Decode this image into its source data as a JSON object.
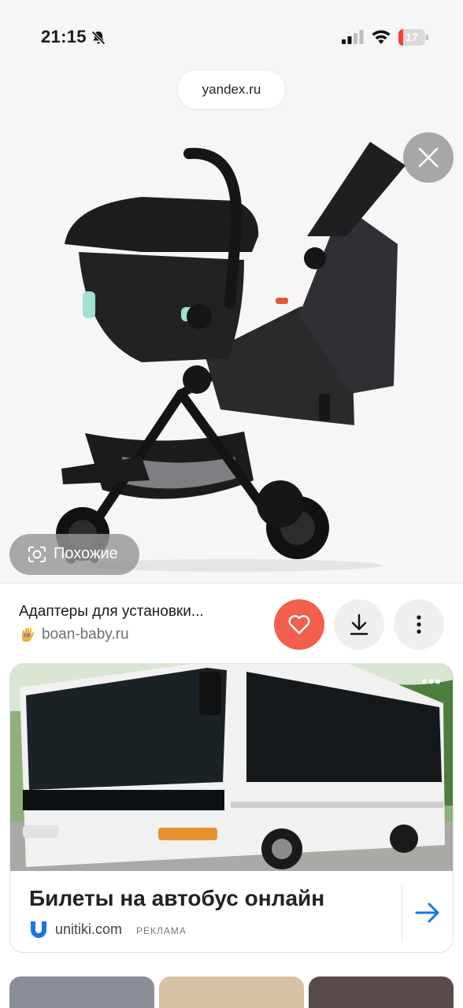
{
  "status_bar": {
    "time": "21:15",
    "battery_level": "17",
    "battery_fraction": 0.17,
    "icons": [
      "bell-slash-icon",
      "signal-icon",
      "wifi-icon",
      "battery-icon"
    ]
  },
  "viewer": {
    "url": "yandex.ru",
    "similar_label": "Похожие",
    "close_icon": "close-icon",
    "image_subject": "stroller-photo"
  },
  "result": {
    "title": "Адаптеры для установки...",
    "source": "boan-baby.ru",
    "actions": [
      "heart-icon",
      "download-icon",
      "more-vertical-icon"
    ],
    "colors": {
      "favorite": "#f25f4c",
      "neutral": "#efefef"
    }
  },
  "ad": {
    "title": "Билеты на автобус онлайн",
    "domain": "unitiki.com",
    "label": "РЕКЛАМА",
    "more_icon": "more-horizontal-icon",
    "arrow_icon": "arrow-right-icon",
    "colors": {
      "brand": "#1a73e8"
    }
  }
}
